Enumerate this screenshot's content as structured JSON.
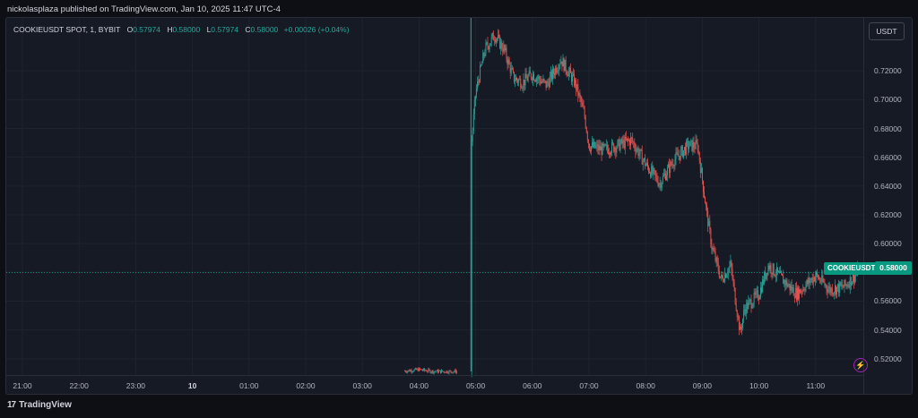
{
  "header": {
    "published": "nickolasplaza published on TradingView.com, Jan 10, 2025 11:47 UTC-4"
  },
  "legend": {
    "symbol": "COOKIEUSDT SPOT, 1, BYBIT",
    "o_label": "O",
    "o": "0.57974",
    "h_label": "H",
    "h": "0.58000",
    "l_label": "L",
    "l": "0.57974",
    "c_label": "C",
    "c": "0.58000",
    "change": "+0.00026 (+0.04%)"
  },
  "currency_button": "USDT",
  "price_tag": {
    "symbol": "COOKIEUSDT",
    "price": "0.58000"
  },
  "footer": {
    "logo": "17",
    "brand": "TradingView"
  },
  "colors": {
    "up": "#26a69a",
    "down": "#ef5350",
    "tag": "#089981",
    "grid": "#1f232e"
  },
  "chart_data": {
    "type": "candlestick",
    "y_ticks": [
      "0.72000",
      "0.70000",
      "0.68000",
      "0.66000",
      "0.64000",
      "0.62000",
      "0.60000",
      "0.58000",
      "0.56000",
      "0.54000",
      "0.52000"
    ],
    "x_ticks": [
      "21:00",
      "22:00",
      "23:00",
      "10",
      "01:00",
      "02:00",
      "03:00",
      "04:00",
      "05:00",
      "06:00",
      "07:00",
      "08:00",
      "09:00",
      "10:00",
      "11:00"
    ],
    "x_bold": [
      "10"
    ],
    "ylim": [
      0.5087,
      0.7568
    ],
    "last_price": 0.58,
    "grid": true,
    "price_path": [
      {
        "t": "03:45",
        "p": 0.5115
      },
      {
        "t": "04:00",
        "p": 0.5125
      },
      {
        "t": "04:15",
        "p": 0.5112
      },
      {
        "t": "04:40",
        "p": 0.5112
      },
      {
        "t": "04:55",
        "p": 0.665
      },
      {
        "t": "05:00",
        "p": 0.705
      },
      {
        "t": "05:10",
        "p": 0.735
      },
      {
        "t": "05:20",
        "p": 0.745
      },
      {
        "t": "05:30",
        "p": 0.735
      },
      {
        "t": "05:40",
        "p": 0.715
      },
      {
        "t": "05:50",
        "p": 0.712
      },
      {
        "t": "06:00",
        "p": 0.718
      },
      {
        "t": "06:15",
        "p": 0.71
      },
      {
        "t": "06:30",
        "p": 0.728
      },
      {
        "t": "06:45",
        "p": 0.712
      },
      {
        "t": "06:55",
        "p": 0.69
      },
      {
        "t": "07:00",
        "p": 0.668
      },
      {
        "t": "07:15",
        "p": 0.665
      },
      {
        "t": "07:30",
        "p": 0.668
      },
      {
        "t": "07:45",
        "p": 0.672
      },
      {
        "t": "08:00",
        "p": 0.655
      },
      {
        "t": "08:15",
        "p": 0.642
      },
      {
        "t": "08:30",
        "p": 0.658
      },
      {
        "t": "08:45",
        "p": 0.668
      },
      {
        "t": "08:55",
        "p": 0.668
      },
      {
        "t": "09:05",
        "p": 0.62
      },
      {
        "t": "09:10",
        "p": 0.598
      },
      {
        "t": "09:20",
        "p": 0.575
      },
      {
        "t": "09:30",
        "p": 0.585
      },
      {
        "t": "09:40",
        "p": 0.538
      },
      {
        "t": "09:45",
        "p": 0.555
      },
      {
        "t": "10:00",
        "p": 0.565
      },
      {
        "t": "10:10",
        "p": 0.585
      },
      {
        "t": "10:25",
        "p": 0.575
      },
      {
        "t": "10:40",
        "p": 0.565
      },
      {
        "t": "11:00",
        "p": 0.578
      },
      {
        "t": "11:15",
        "p": 0.568
      },
      {
        "t": "11:30",
        "p": 0.57
      },
      {
        "t": "11:45",
        "p": 0.58
      }
    ]
  }
}
